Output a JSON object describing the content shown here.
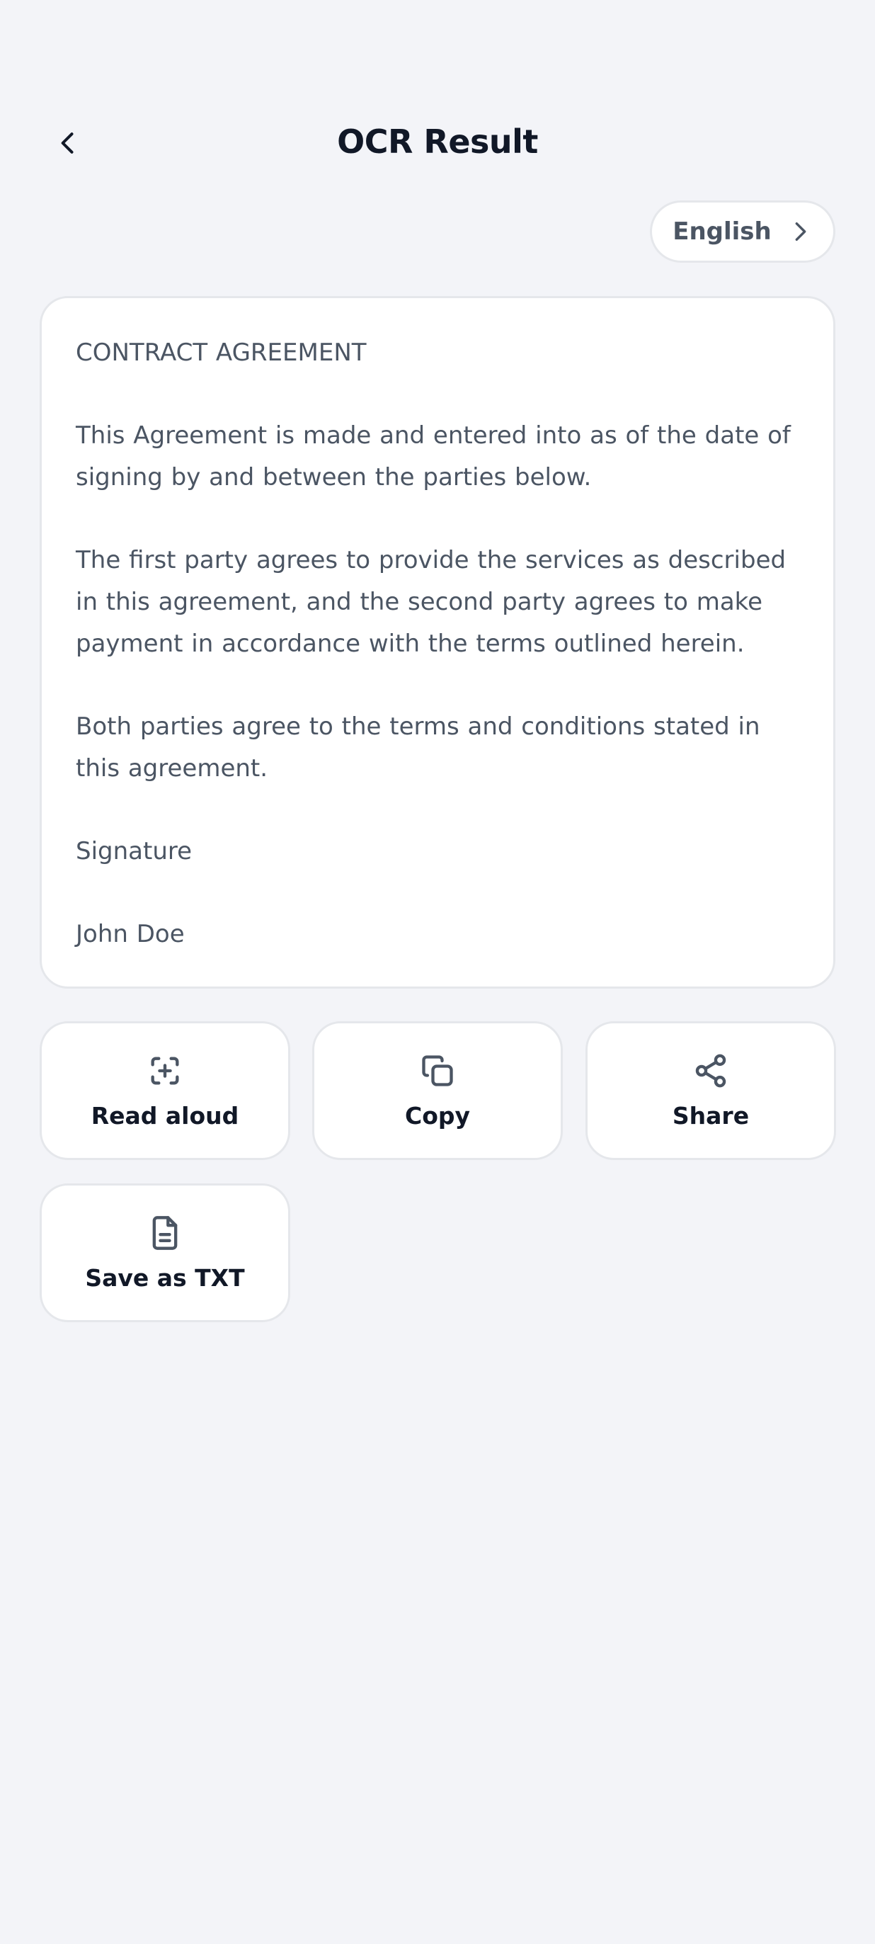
{
  "header": {
    "title": "OCR Result"
  },
  "language": {
    "label": "English"
  },
  "ocr_text": {
    "paragraphs": [
      "CONTRACT AGREEMENT",
      "This Agreement is made and entered into as of the date of signing by and between the parties below.",
      "The first party agrees to provide the services as described in this agreement, and the second party agrees to make payment in accordance with the terms outlined herein.",
      "Both parties agree to the terms and conditions stated in this agreement.",
      "Signature",
      "John Doe"
    ]
  },
  "actions": {
    "read_aloud": {
      "label": "Read aloud",
      "icon": "scan-add-icon"
    },
    "copy": {
      "label": "Copy",
      "icon": "copy-icon"
    },
    "share": {
      "label": "Share",
      "icon": "share-icon"
    },
    "save_txt": {
      "label": "Save as TXT",
      "icon": "file-text-icon"
    }
  },
  "colors": {
    "background": "#f3f4f8",
    "card": "#ffffff",
    "border": "#e5e7eb",
    "text_primary": "#111827",
    "text_secondary": "#4b5563"
  }
}
